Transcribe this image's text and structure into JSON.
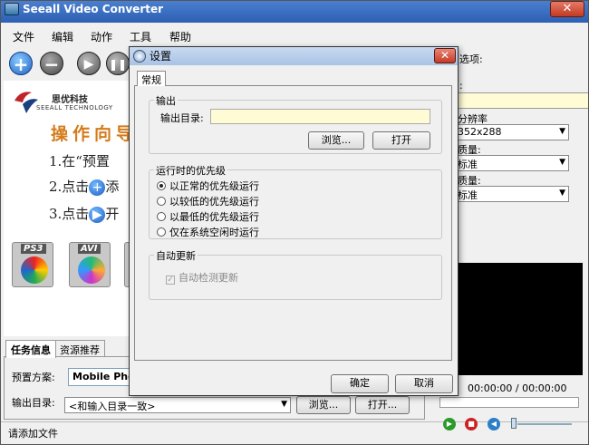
{
  "app": {
    "title": "Seeall Video Converter"
  },
  "menu": [
    "文件",
    "编辑",
    "动作",
    "工具",
    "帮助"
  ],
  "logo": {
    "name_cn": "思优科技",
    "name_en": "SEEALL TECHNOLOGY"
  },
  "guide": {
    "title": "操作向导",
    "steps": [
      "1.在“预置",
      "2.点击",
      "3.点击"
    ],
    "step_icons": [
      "plus-icon",
      "play-icon"
    ],
    "step_suffix": [
      "添",
      "开"
    ]
  },
  "formats": [
    {
      "label": "PS3",
      "icon": "ps3-format-icon"
    },
    {
      "label": "AVI",
      "icon": "avi-format-icon"
    }
  ],
  "tabs": [
    "任务信息",
    "资源推荐"
  ],
  "task": {
    "preset_label": "预置方案:",
    "preset_value": "Mobile Phone",
    "outdir_label": "输出目录:",
    "outdir_value": "<和输入目录一致>",
    "browse": "浏览...",
    "open": "打开..."
  },
  "status": "请添加文件",
  "right": {
    "options_header": "选项:",
    "name_suffix": ":",
    "resolution_label": "分辨率",
    "resolution_value": "352x288",
    "video_quality_label": "质量:",
    "video_quality_value": "标准",
    "audio_quality_label": "质量:",
    "audio_quality_value": "标准",
    "time": "00:00:00 / 00:00:00"
  },
  "dialog": {
    "title": "设置",
    "tab": "常规",
    "output_group": "输出",
    "output_dir_label": "输出目录:",
    "browse": "浏览...",
    "open": "打开",
    "priority_group": "运行时的优先级",
    "priorities": [
      "以正常的优先级运行",
      "以较低的优先级运行",
      "以最低的优先级运行",
      "仅在系统空闲时运行"
    ],
    "selected_priority": 0,
    "update_group": "自动更新",
    "auto_check": "自动检测更新",
    "ok": "确定",
    "cancel": "取消"
  }
}
